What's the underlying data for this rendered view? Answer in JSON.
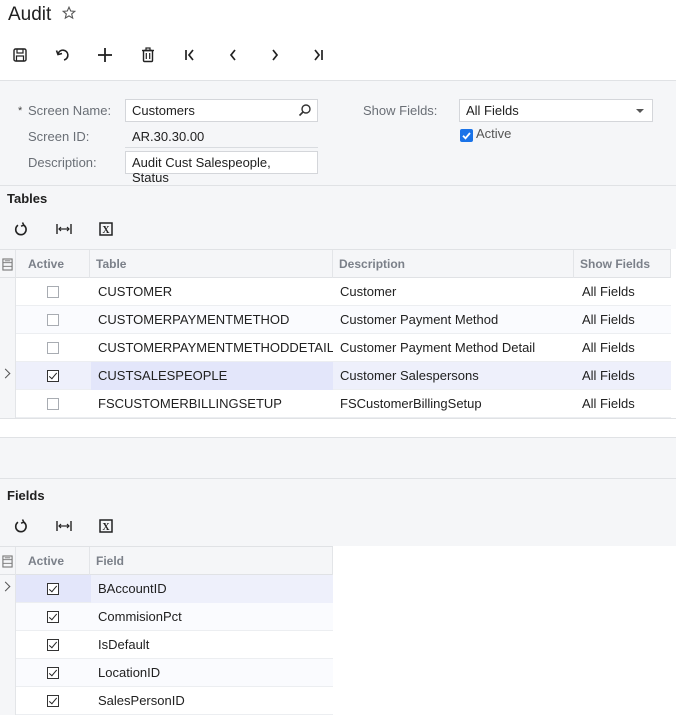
{
  "header": {
    "title": "Audit",
    "favorite_icon": "star-outline-icon"
  },
  "toolbar": {
    "buttons": [
      {
        "name": "save",
        "icon": "save-icon"
      },
      {
        "name": "undo",
        "icon": "undo-icon"
      },
      {
        "name": "add",
        "icon": "plus-icon"
      },
      {
        "name": "delete",
        "icon": "trash-icon"
      },
      {
        "name": "first",
        "icon": "first-record-icon"
      },
      {
        "name": "previous",
        "icon": "chevron-left-icon"
      },
      {
        "name": "next",
        "icon": "chevron-right-icon"
      },
      {
        "name": "last",
        "icon": "last-record-icon"
      }
    ]
  },
  "form": {
    "screen_name_label": "Screen Name:",
    "screen_name_required": "*",
    "screen_name_value": "Customers",
    "screen_id_label": "Screen ID:",
    "screen_id_value": "AR.30.30.00",
    "description_label": "Description:",
    "description_value": "Audit Cust Salespeople, Status",
    "show_fields_label": "Show Fields:",
    "show_fields_value": "All Fields",
    "active_label": "Active",
    "active_checked": true
  },
  "tables_section": {
    "title": "Tables",
    "toolbar": [
      "refresh-icon",
      "fit-columns-icon",
      "export-excel-icon"
    ],
    "columns": [
      "Active",
      "Table",
      "Description",
      "Show Fields"
    ],
    "rows": [
      {
        "active": false,
        "table": "CUSTOMER",
        "description": "Customer",
        "show_fields": "All Fields",
        "selected": false
      },
      {
        "active": false,
        "table": "CUSTOMERPAYMENTMETHOD",
        "description": "Customer Payment Method",
        "show_fields": "All Fields",
        "selected": false
      },
      {
        "active": false,
        "table": "CUSTOMERPAYMENTMETHODDETAIL",
        "description": "Customer Payment Method Detail",
        "show_fields": "All Fields",
        "selected": false
      },
      {
        "active": true,
        "table": "CUSTSALESPEOPLE",
        "description": "Customer Salespersons",
        "show_fields": "All Fields",
        "selected": true
      },
      {
        "active": false,
        "table": "FSCUSTOMERBILLINGSETUP",
        "description": "FSCustomerBillingSetup",
        "show_fields": "All Fields",
        "selected": false
      }
    ]
  },
  "fields_section": {
    "title": "Fields",
    "toolbar": [
      "refresh-icon",
      "fit-columns-icon",
      "export-excel-icon"
    ],
    "columns": [
      "Active",
      "Field"
    ],
    "rows": [
      {
        "active": true,
        "field": "BAccountID",
        "selected": true
      },
      {
        "active": true,
        "field": "CommisionPct",
        "selected": false
      },
      {
        "active": true,
        "field": "IsDefault",
        "selected": false
      },
      {
        "active": true,
        "field": "LocationID",
        "selected": false
      },
      {
        "active": true,
        "field": "SalesPersonID",
        "selected": false
      }
    ]
  }
}
